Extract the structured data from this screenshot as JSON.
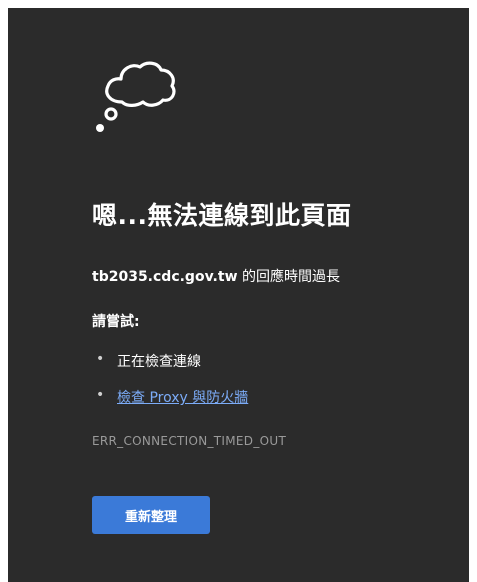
{
  "error_page": {
    "icon": "thought-cloud-icon",
    "headline": "嗯...無法連線到此頁面",
    "detail": {
      "host": "tb2035.cdc.gov.tw",
      "message": " 的回應時間過長"
    },
    "try_heading": "請嘗試:",
    "suggestions": [
      {
        "text": "正在檢查連線",
        "is_link": false
      },
      {
        "text": "檢查 Proxy 與防火牆",
        "is_link": true
      }
    ],
    "bullet": "•",
    "error_code": "ERR_CONNECTION_TIMED_OUT",
    "reload_button_label": "重新整理"
  },
  "colors": {
    "background": "#2b2b2b",
    "link": "#7cacf8",
    "button": "#3b7ad8",
    "muted_text": "#9a9a9a"
  }
}
